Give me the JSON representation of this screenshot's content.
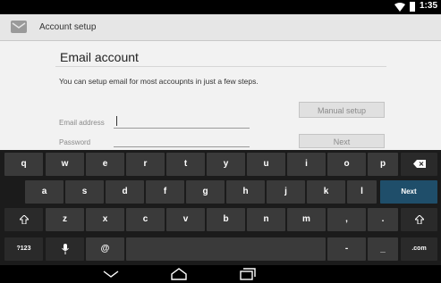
{
  "status_bar": {
    "time": "1:35"
  },
  "action_bar": {
    "title": "Account setup"
  },
  "setup": {
    "heading": "Email account",
    "description": "You can setup email for most accoupnts in just a few steps.",
    "email_label": "Email address",
    "password_label": "Password",
    "manual_setup": "Manual setup",
    "next": "Next"
  },
  "keyboard": {
    "row1": [
      "q",
      "w",
      "e",
      "r",
      "t",
      "y",
      "u",
      "i",
      "o",
      "p"
    ],
    "row2": [
      "a",
      "s",
      "d",
      "f",
      "g",
      "h",
      "j",
      "k",
      "l"
    ],
    "row3": [
      "z",
      "x",
      "c",
      "v",
      "b",
      "n",
      "m",
      ",",
      "."
    ],
    "enter_label": "Next",
    "mode_label": "?123",
    "at_label": "@",
    "dash_label": "-",
    "underscore_label": "_",
    "com_label": ".com"
  }
}
